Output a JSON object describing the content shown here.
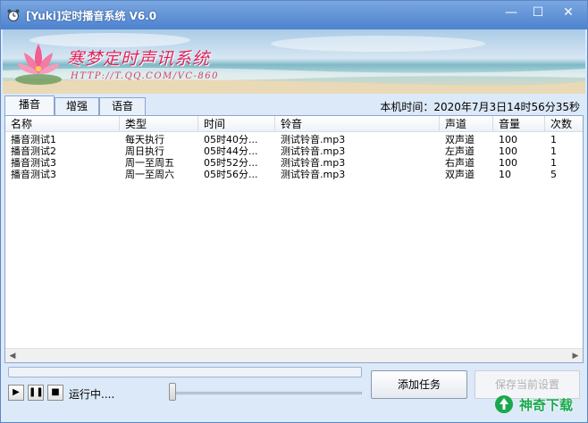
{
  "window": {
    "title": "[Yuki]定时播音系统 V6.0",
    "controls": {
      "minimize": "—",
      "maximize": "☐",
      "close": "✕"
    }
  },
  "banner": {
    "title": "寒梦定时声讯系统",
    "url": "HTTP://T.QQ.COM/VC-860",
    "logo_icon": "lotus-icon"
  },
  "tabs": [
    {
      "label": "播音",
      "active": true
    },
    {
      "label": "增强",
      "active": false
    },
    {
      "label": "语音",
      "active": false
    }
  ],
  "clock": {
    "text": "本机时间：2020年7月3日14时56分35秒"
  },
  "table": {
    "columns": [
      "名称",
      "类型",
      "时间",
      "铃音",
      "声道",
      "音量",
      "次数"
    ],
    "rows": [
      {
        "name": "播音测试1",
        "type": "每天执行",
        "time": "05时40分...",
        "sound": "测试铃音.mp3",
        "channel": "双声道",
        "volume": "100",
        "count": "1"
      },
      {
        "name": "播音测试2",
        "type": "周日执行",
        "time": "05时44分...",
        "sound": "测试铃音.mp3",
        "channel": "左声道",
        "volume": "100",
        "count": "1"
      },
      {
        "name": "播音测试3",
        "type": "周一至周五",
        "time": "05时52分...",
        "sound": "测试铃音.mp3",
        "channel": "右声道",
        "volume": "100",
        "count": "1"
      },
      {
        "name": "播音测试3",
        "type": "周一至周六",
        "time": "05时56分...",
        "sound": "测试铃音.mp3",
        "channel": "双声道",
        "volume": "10",
        "count": "5"
      }
    ]
  },
  "player": {
    "status": "运行中....",
    "progress_fraction": 0.0,
    "volume_fraction": 0.0,
    "play_icon": "▶",
    "pause_icon": "❚❚",
    "stop_icon": "■"
  },
  "buttons": {
    "add_task": "添加任务",
    "save": "保存当前设置"
  },
  "watermark": {
    "text": "神奇下载"
  },
  "colors": {
    "accent": "#4d82cf",
    "banner_title": "#e0245a",
    "watermark": "#1aa84f"
  }
}
